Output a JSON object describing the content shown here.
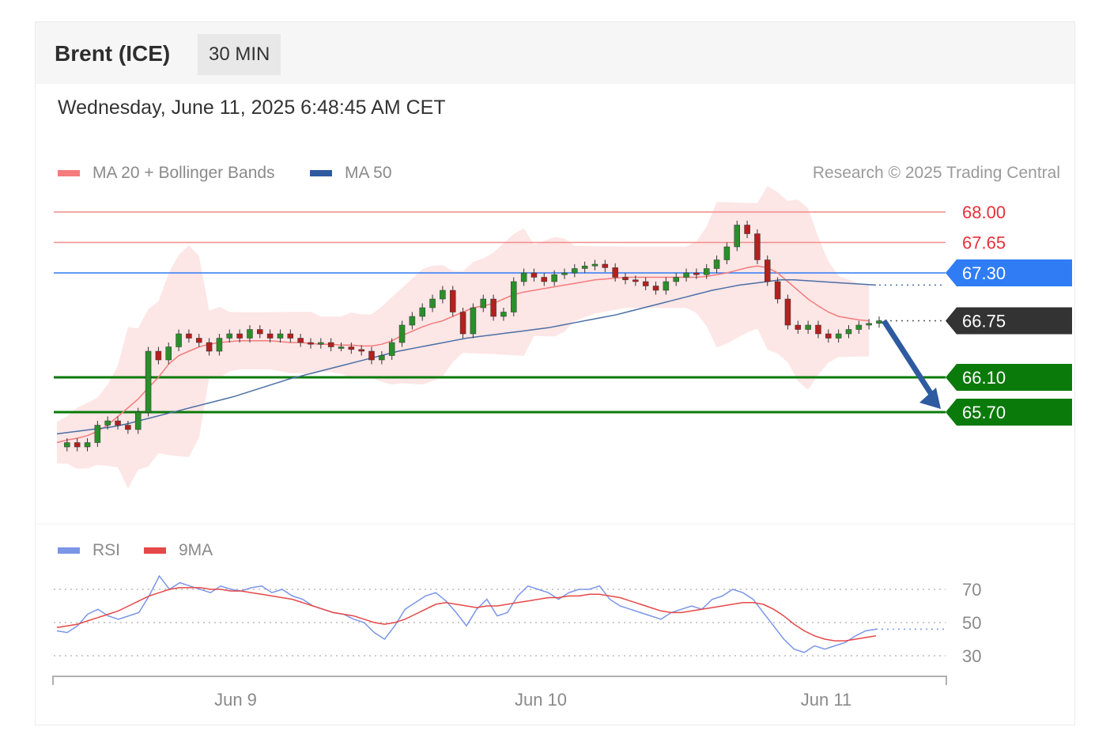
{
  "header": {
    "instrument": "Brent (ICE)",
    "timeframe": "30 MIN",
    "datetime": "Wednesday, June 11, 2025 6:48:45 AM CET"
  },
  "legend": {
    "ma20": "MA 20 + Bollinger Bands",
    "ma50": "MA 50",
    "copyright": "Research © 2025 Trading Central"
  },
  "rsi_legend": {
    "rsi": "RSI",
    "ma9": "9MA"
  },
  "colors": {
    "resistance": "#f28b8b",
    "pivot": "#2f7cf5",
    "support": "#0a7a0a",
    "current": "#333333",
    "ma20": "#f47c7c",
    "ma50": "#4a6fa5",
    "band": "#fde2e2",
    "bull": "#2a8f2a",
    "bear": "#b51f1f",
    "arrow": "#2e5aa0",
    "rsi": "#7b96e8",
    "rsi_ma": "#e54848"
  },
  "chart_data": [
    {
      "type": "candlestick",
      "ylim": [
        65.0,
        68.0
      ],
      "x_ticks": [
        "Jun 9",
        "Jun 10",
        "Jun 11"
      ],
      "levels": [
        {
          "label": "68.00",
          "value": 68.0,
          "kind": "resistance"
        },
        {
          "label": "67.65",
          "value": 67.65,
          "kind": "resistance"
        },
        {
          "label": "67.30",
          "value": 67.3,
          "kind": "pivot"
        },
        {
          "label": "66.75",
          "value": 66.75,
          "kind": "current"
        },
        {
          "label": "66.10",
          "value": 66.1,
          "kind": "support"
        },
        {
          "label": "65.70",
          "value": 65.7,
          "kind": "support"
        }
      ],
      "forecast": {
        "from": 66.75,
        "to": 65.7,
        "direction": "down"
      },
      "close": [
        65.3,
        65.35,
        65.3,
        65.35,
        65.55,
        65.6,
        65.55,
        65.5,
        65.7,
        66.4,
        66.3,
        66.45,
        66.6,
        66.55,
        66.5,
        66.4,
        66.55,
        66.6,
        66.55,
        66.65,
        66.6,
        66.55,
        66.6,
        66.55,
        66.5,
        66.48,
        66.5,
        66.45,
        66.45,
        66.42,
        66.4,
        66.3,
        66.35,
        66.5,
        66.7,
        66.8,
        66.9,
        67.0,
        67.1,
        66.85,
        66.6,
        66.9,
        67.0,
        66.8,
        66.85,
        67.2,
        67.3,
        67.25,
        67.2,
        67.28,
        67.3,
        67.35,
        67.38,
        67.4,
        67.36,
        67.25,
        67.22,
        67.2,
        67.15,
        67.1,
        67.2,
        67.25,
        67.3,
        67.28,
        67.35,
        67.45,
        67.6,
        67.85,
        67.75,
        67.45,
        67.2,
        67.0,
        66.7,
        66.65,
        66.7,
        66.6,
        66.55,
        66.6,
        66.65,
        66.7,
        66.72,
        66.75
      ],
      "ma20": [
        65.35,
        65.38,
        65.4,
        65.43,
        65.48,
        65.55,
        65.65,
        65.75,
        65.85,
        65.98,
        66.1,
        66.25,
        66.35,
        66.4,
        66.45,
        66.48,
        66.5,
        66.51,
        66.52,
        66.52,
        66.52,
        66.52,
        66.51,
        66.5,
        66.5,
        66.49,
        66.48,
        66.48,
        66.47,
        66.47,
        66.46,
        66.46,
        66.48,
        66.52,
        66.58,
        66.63,
        66.68,
        66.72,
        66.75,
        66.8,
        66.85,
        66.9,
        66.92,
        66.95,
        67.0,
        67.05,
        67.08,
        67.1,
        67.12,
        67.14,
        67.16,
        67.18,
        67.2,
        67.22,
        67.23,
        67.24,
        67.25,
        67.25,
        67.25,
        67.25,
        67.25,
        67.25,
        67.25,
        67.25,
        67.26,
        67.28,
        67.3,
        67.33,
        67.36,
        67.38,
        67.36,
        67.3,
        67.2,
        67.1,
        67.0,
        66.92,
        66.85,
        66.8,
        66.78,
        66.76,
        66.75
      ],
      "ma50": [
        65.45,
        65.47,
        65.49,
        65.51,
        65.53,
        65.56,
        65.6,
        65.64,
        65.68,
        65.72,
        65.76,
        65.8,
        65.84,
        65.88,
        65.93,
        65.98,
        66.03,
        66.08,
        66.12,
        66.16,
        66.2,
        66.24,
        66.28,
        66.32,
        66.36,
        66.4,
        66.43,
        66.46,
        66.49,
        66.52,
        66.55,
        66.57,
        66.59,
        66.61,
        66.63,
        66.65,
        66.67,
        66.7,
        66.73,
        66.76,
        66.79,
        66.82,
        66.86,
        66.9,
        66.94,
        66.98,
        67.02,
        67.06,
        67.1,
        67.13,
        67.16,
        67.18,
        67.2,
        67.22,
        67.22,
        67.21,
        67.2,
        67.19,
        67.18,
        67.17,
        67.16
      ]
    },
    {
      "type": "line",
      "ylim": [
        20,
        90
      ],
      "y_ticks": [
        "70",
        "50",
        "30"
      ],
      "reference_lines": [
        70,
        50,
        30
      ],
      "series": [
        {
          "key": "rsi",
          "values": [
            45,
            44,
            48,
            55,
            58,
            54,
            52,
            54,
            56,
            66,
            78,
            70,
            74,
            72,
            70,
            68,
            72,
            70,
            69,
            71,
            72,
            68,
            70,
            66,
            64,
            60,
            58,
            56,
            55,
            52,
            50,
            44,
            40,
            48,
            58,
            62,
            66,
            68,
            63,
            56,
            48,
            58,
            64,
            54,
            56,
            66,
            72,
            70,
            68,
            64,
            68,
            70,
            70,
            72,
            64,
            60,
            58,
            56,
            54,
            52,
            56,
            58,
            60,
            58,
            64,
            66,
            70,
            68,
            64,
            56,
            48,
            40,
            34,
            32,
            36,
            34,
            36,
            38,
            42,
            45,
            46
          ]
        },
        {
          "key": "rsi_ma",
          "values": [
            47,
            48,
            49,
            51,
            53,
            55,
            57,
            60,
            63,
            66,
            68,
            70,
            71,
            71,
            71,
            70,
            70,
            69,
            69,
            68,
            67,
            66,
            65,
            64,
            62,
            60,
            58,
            56,
            55,
            54,
            52,
            50,
            49,
            50,
            52,
            55,
            58,
            61,
            62,
            61,
            60,
            59,
            60,
            60,
            61,
            62,
            63,
            64,
            65,
            65,
            66,
            66,
            67,
            67,
            66,
            65,
            63,
            61,
            59,
            57,
            56,
            56,
            57,
            58,
            59,
            60,
            61,
            62,
            62,
            61,
            58,
            54,
            49,
            45,
            42,
            40,
            39,
            39,
            40,
            41,
            42
          ]
        }
      ]
    }
  ]
}
